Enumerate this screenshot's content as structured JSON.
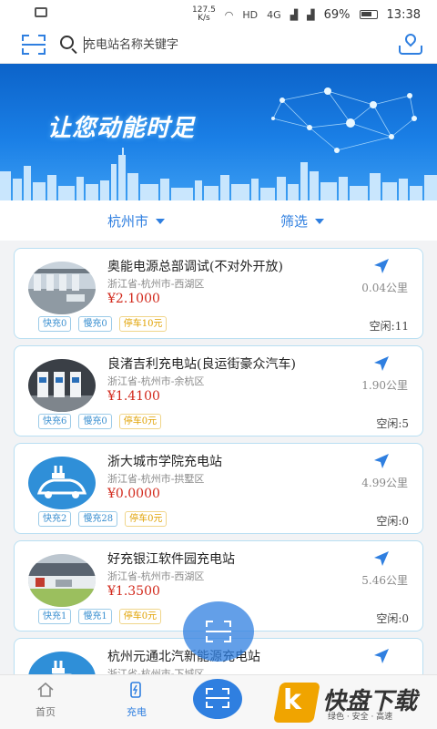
{
  "status_bar": {
    "net_speed_value": "127.5",
    "net_speed_unit": "K/s",
    "hd": "HD",
    "network": "4G",
    "battery": "69%",
    "time": "13:38"
  },
  "search": {
    "placeholder": "充电站名称关键字"
  },
  "banner": {
    "slogan": "让您动能时足"
  },
  "filters": {
    "city": "杭州市",
    "screen": "筛选"
  },
  "stations": [
    {
      "name": "奥能电源总部调试(不对外开放)",
      "address": "浙江省-杭州市-西湖区",
      "price": "¥2.1000",
      "distance": "0.04公里",
      "fast": "快充0",
      "slow": "慢充0",
      "parking": "停车10元",
      "idle": "空闲:11"
    },
    {
      "name": "良渚吉利充电站(良运街豪众汽车)",
      "address": "浙江省-杭州市-余杭区",
      "price": "¥1.4100",
      "distance": "1.90公里",
      "fast": "快充6",
      "slow": "慢充0",
      "parking": "停车0元",
      "idle": "空闲:5"
    },
    {
      "name": "浙大城市学院充电站",
      "address": "浙江省-杭州市-拱墅区",
      "price": "¥0.0000",
      "distance": "4.99公里",
      "fast": "快充2",
      "slow": "慢充28",
      "parking": "停车0元",
      "idle": "空闲:0"
    },
    {
      "name": "好充银江软件园充电站",
      "address": "浙江省-杭州市-西湖区",
      "price": "¥1.3500",
      "distance": "5.46公里",
      "fast": "快充1",
      "slow": "慢充1",
      "parking": "停车0元",
      "idle": "空闲:0"
    },
    {
      "name": "杭州元通北汽新能源充电站",
      "address": "浙江省-杭州市-下城区"
    }
  ],
  "tabbar": {
    "home": "首页",
    "charge": "充电"
  },
  "watermark": {
    "logo_char": "k",
    "brand": "快盘下载",
    "slogan": "绿色 · 安全 · 高速"
  },
  "colors": {
    "accent": "#2f7fe0",
    "price": "#d2291c",
    "card_border": "#b9dff2"
  }
}
